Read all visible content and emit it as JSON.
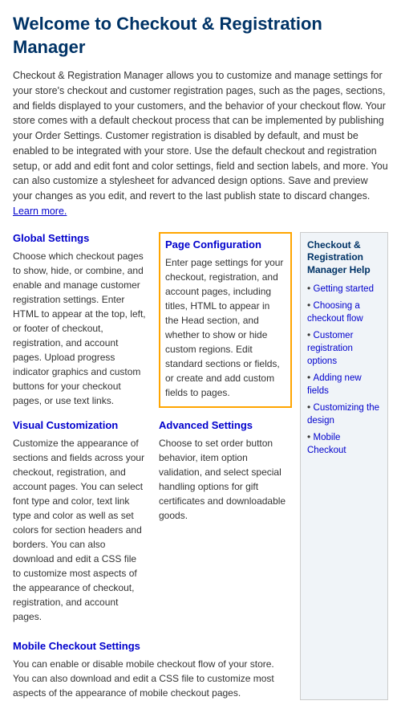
{
  "page": {
    "title": "Welcome to Checkout & Registration Manager",
    "intro": "Checkout & Registration Manager allows you to customize and manage settings for your store's checkout and customer registration pages, such as the pages, sections, and fields displayed to your customers, and the behavior of your checkout flow. Your store comes with a default checkout process that can be implemented by publishing your Order Settings. Customer registration is disabled by default, and must be enabled to be integrated with your store. Use the default checkout and registration setup, or add and edit font and color settings, field and section labels, and more. You can also customize a stylesheet for advanced design options. Save and preview your changes as you edit, and revert to the last publish state to discard changes.",
    "intro_link_text": "Learn more.",
    "intro_link_url": "#"
  },
  "sections": [
    {
      "id": "global-settings",
      "title": "Global Settings",
      "highlighted": false,
      "text": "Choose which checkout pages to show, hide, or combine, and enable and manage customer registration settings. Enter HTML to appear at the top, left, or footer of checkout, registration, and account pages. Upload progress indicator graphics and custom buttons for your checkout pages, or use text links."
    },
    {
      "id": "page-configuration",
      "title": "Page Configuration",
      "highlighted": true,
      "text": "Enter page settings for your checkout, registration, and account pages, including titles, HTML to appear in the Head section, and whether to show or hide custom regions. Edit standard sections or fields, or create and add custom fields to pages."
    },
    {
      "id": "visual-customization",
      "title": "Visual Customization",
      "highlighted": false,
      "text": "Customize the appearance of sections and fields across your checkout, registration, and account pages. You can select font type and color, text link type and color as well as set colors for section headers and borders. You can also download and edit a CSS file to customize most aspects of the appearance of checkout, registration, and account pages."
    },
    {
      "id": "advanced-settings",
      "title": "Advanced Settings",
      "highlighted": false,
      "text": "Choose to set order button behavior, item option validation, and select special handling options for gift certificates and downloadable goods."
    }
  ],
  "mobile_section": {
    "title": "Mobile Checkout Settings",
    "text": "You can enable or disable mobile checkout flow of your store. You can also download and edit a CSS file to customize most aspects of the appearance of mobile checkout pages."
  },
  "sidebar": {
    "title": "Checkout & Registration Manager Help",
    "links": [
      {
        "label": "Getting started",
        "url": "#"
      },
      {
        "label": "Choosing a checkout flow",
        "url": "#"
      },
      {
        "label": "Customer registration options",
        "url": "#"
      },
      {
        "label": "Adding new fields",
        "url": "#"
      },
      {
        "label": "Customizing the design",
        "url": "#"
      },
      {
        "label": "Mobile Checkout",
        "url": "#"
      }
    ]
  }
}
